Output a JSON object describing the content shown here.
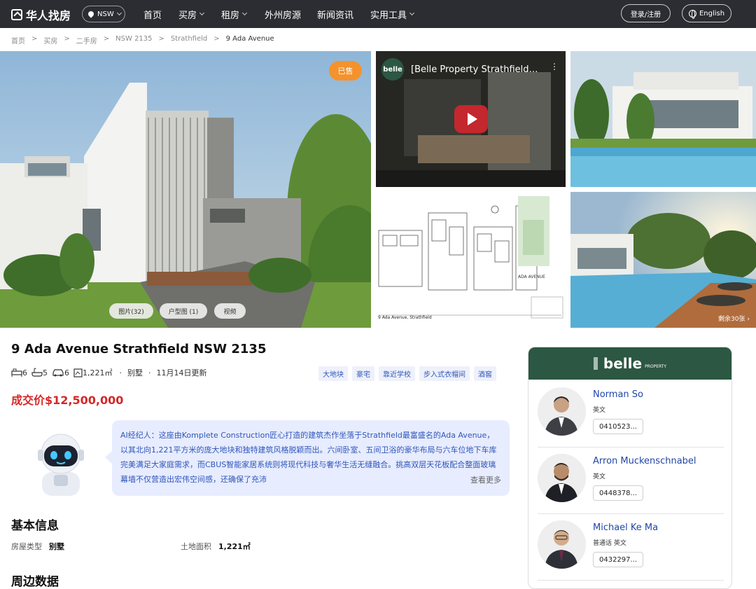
{
  "brand": {
    "name": "华人找房"
  },
  "header": {
    "region": "NSW",
    "nav": [
      {
        "label": "首页",
        "dropdown": false
      },
      {
        "label": "买房",
        "dropdown": true
      },
      {
        "label": "租房",
        "dropdown": true
      },
      {
        "label": "外州房源",
        "dropdown": false
      },
      {
        "label": "新闻资讯",
        "dropdown": false
      },
      {
        "label": "实用工具",
        "dropdown": true
      }
    ],
    "login": "登录/注册",
    "language": "English"
  },
  "breadcrumb": [
    "首页",
    "买房",
    "二手房",
    "NSW 2135",
    "Strathfield",
    "9 Ada Avenue"
  ],
  "gallery": {
    "sold_badge": "已售",
    "buttons": [
      "图片(32)",
      "户型图 (1)",
      "视频"
    ],
    "video_title": "[Belle Property Strathfield…",
    "remaining": "剩余30张",
    "floorplan_caption": "9 Ada Avenue, Strathfield",
    "floorplan_street": "ADA AVENUE",
    "video_logo": "belle"
  },
  "listing": {
    "title": "9 Ada Avenue Strathfield NSW 2135",
    "bedrooms": "6",
    "bathrooms": "5",
    "parking": "6",
    "land": "1,221㎡",
    "type": "别墅",
    "updated": "11月14日更新",
    "tags": [
      "大地块",
      "豪宅",
      "靠近学校",
      "步入式衣帽间",
      "酒窖"
    ],
    "price_label": "成交价$12,500,000"
  },
  "ai_agent": {
    "text": "AI经纪人：这座由Komplete Construction匠心打造的建筑杰作坐落于Strathfield最富盛名的Ada Avenue，以其北向1,221平方米的庞大地块和独特建筑风格脱颖而出。六间卧室、五间卫浴的豪华布局与六车位地下车库完美满足大家庭需求，而CBUS智能家居系统则将现代科技与奢华生活无缝融合。挑高双层天花板配合整面玻璃幕墙不仅营造出宏伟空间感，还确保了充沛",
    "more": "查看更多"
  },
  "basic_info": {
    "heading": "基本信息",
    "house_type_label": "房屋类型",
    "house_type_value": "别墅",
    "land_label": "土地面积",
    "land_value": "1,221㎡"
  },
  "nearby": {
    "heading": "周边数据"
  },
  "agency": {
    "logo": "belle",
    "logo_sub": "PROPERTY"
  },
  "agents": [
    {
      "name": "Norman So",
      "languages": "英文",
      "phone": "0410523..."
    },
    {
      "name": "Arron Muckenschnabel",
      "languages": "英文",
      "phone": "0448378..."
    },
    {
      "name": "Michael Ke Ma",
      "languages": "普通话  英文",
      "phone": "0432297..."
    }
  ],
  "colors": {
    "accent": "#f5922c",
    "price": "#d52727",
    "link": "#2046a8",
    "agency": "#2c5742"
  }
}
